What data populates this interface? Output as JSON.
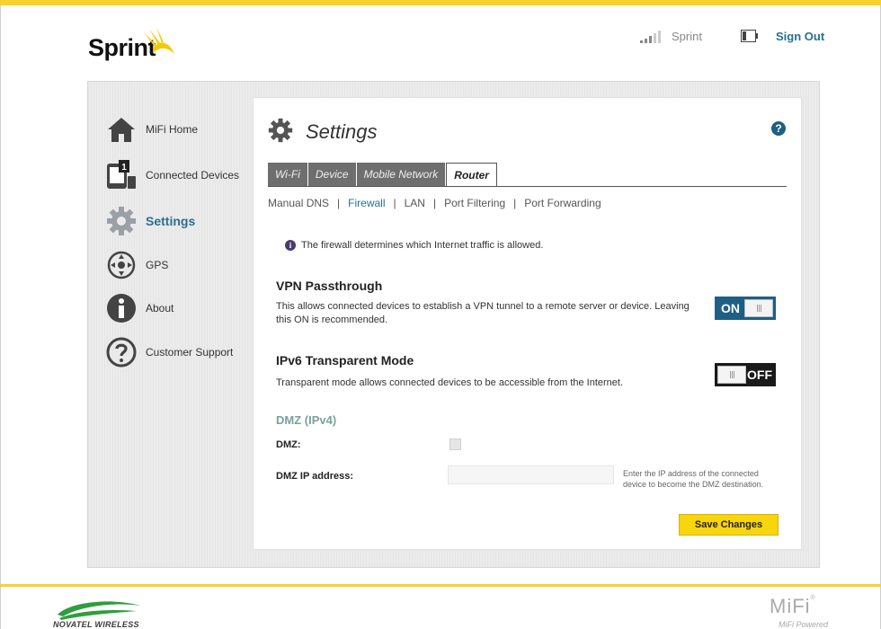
{
  "header": {
    "brand": "Sprint",
    "carrier": "Sprint",
    "sign_out": "Sign Out"
  },
  "sidebar": {
    "items": [
      {
        "label": "MiFi Home",
        "icon": "home-icon"
      },
      {
        "label": "Connected Devices",
        "icon": "devices-icon",
        "badge": "1"
      },
      {
        "label": "Settings",
        "icon": "gear-icon",
        "active": true
      },
      {
        "label": "GPS",
        "icon": "gps-icon"
      },
      {
        "label": "About",
        "icon": "info-icon"
      },
      {
        "label": "Customer Support",
        "icon": "question-icon"
      }
    ]
  },
  "main": {
    "title": "Settings",
    "help": "?",
    "tabs": [
      {
        "label": "Wi-Fi"
      },
      {
        "label": "Device"
      },
      {
        "label": "Mobile Network"
      },
      {
        "label": "Router",
        "active": true
      }
    ],
    "subnav": [
      {
        "label": "Manual DNS"
      },
      {
        "label": "Firewall",
        "active": true
      },
      {
        "label": "LAN"
      },
      {
        "label": "Port Filtering"
      },
      {
        "label": "Port Forwarding"
      }
    ],
    "info": "The firewall determines which Internet traffic is allowed.",
    "vpn": {
      "title": "VPN Passthrough",
      "desc_line1": "This allows connected devices to establish a VPN tunnel to a remote server or device. Leaving",
      "desc_line2": "this ON is recommended.",
      "state": "ON"
    },
    "ipv6": {
      "title": "IPv6 Transparent Mode",
      "desc": "Transparent mode allows connected devices to be accessible from the Internet.",
      "state": "OFF"
    },
    "dmz": {
      "heading": "DMZ (IPv4)",
      "dmz_label": "DMZ:",
      "ip_label": "DMZ IP address:",
      "ip_value": "",
      "hint_line1": "Enter the IP address of the connected",
      "hint_line2": "device to become the DMZ destination."
    },
    "save": "Save Changes"
  },
  "footer": {
    "novatel": "NOVATEL WIRELESS",
    "mifi": "MiFi",
    "mifi_sub": "MiFi Powered"
  },
  "colors": {
    "accent": "#2a6f8e",
    "brand_yellow": "#f5d32b",
    "save_button": "#f8d50c",
    "toggle_on": "#1f5f82",
    "toggle_off": "#1a1a1a"
  }
}
